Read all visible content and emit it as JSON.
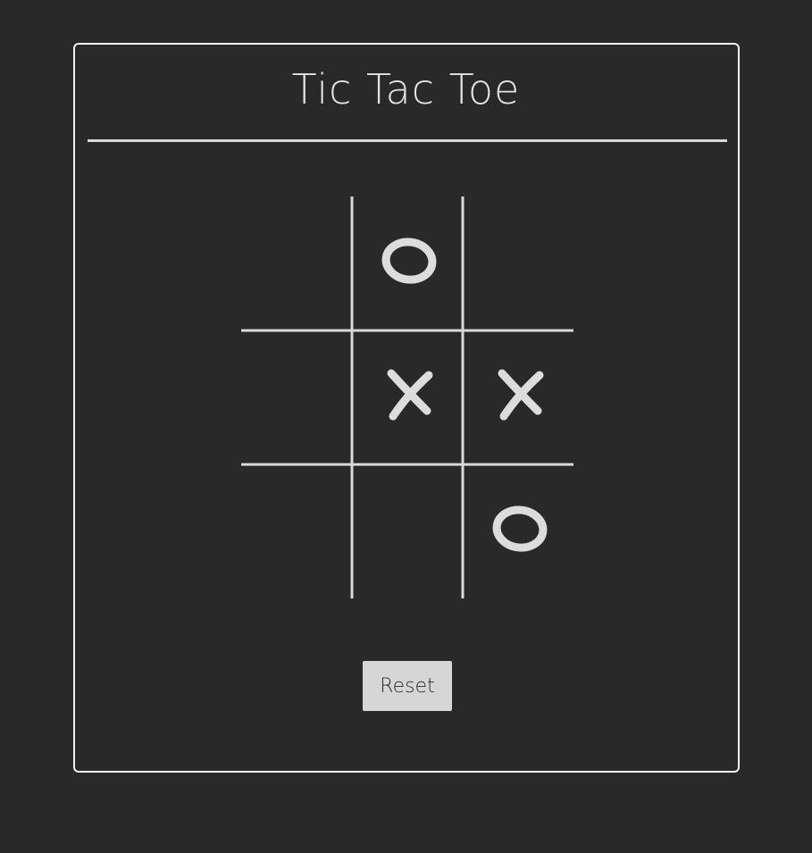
{
  "game": {
    "title": "Tic Tac Toe",
    "reset_label": "Reset",
    "board": [
      [
        "",
        "O",
        ""
      ],
      [
        "",
        "X",
        "X"
      ],
      [
        "",
        "",
        "O"
      ]
    ]
  },
  "colors": {
    "background": "#292929",
    "panel_border": "#f0f0f0",
    "lines": "#d9d9d9",
    "marks": "#dcdcdc",
    "button_bg": "#d6d6d6",
    "button_text": "#2a2a2a"
  }
}
